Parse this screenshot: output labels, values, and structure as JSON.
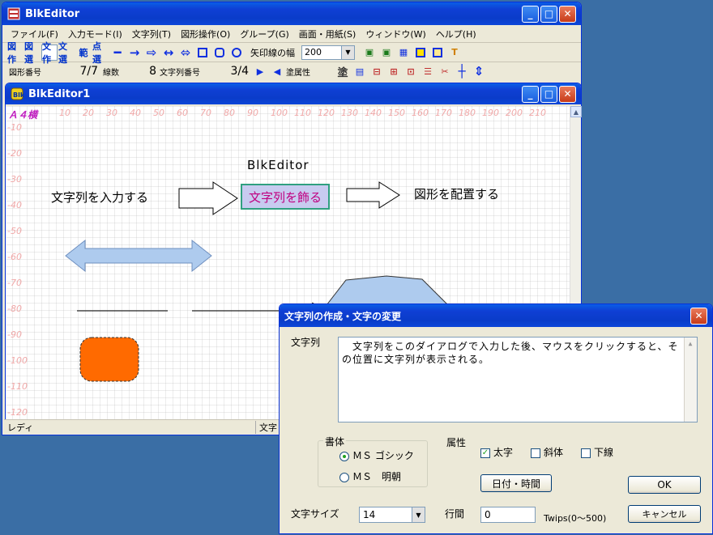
{
  "main_window": {
    "title": "BlkEditor",
    "menu": [
      "ファイル(F)",
      "入力モード(I)",
      "文字列(T)",
      "図形操作(O)",
      "グループ(G)",
      "画面・用紙(S)",
      "ウィンドウ(W)",
      "ヘルプ(H)"
    ],
    "toolbar": {
      "mode_buttons": [
        "図作",
        "図選",
        "文作",
        "文選",
        "範",
        "点選"
      ],
      "arrow_width_label": "矢印線の幅",
      "arrow_width_value": "200"
    },
    "toolbar2": {
      "shape_no_label": "図形番号",
      "shape_no_value": "7/7",
      "line_count_label": "線数",
      "line_count_value": "8",
      "string_no_label": "文字列番号",
      "string_no_value": "3/4",
      "fill_attr_label": "塗属性",
      "fill_glyph": "塗"
    },
    "status": [
      "レディ",
      "文字"
    ]
  },
  "child_window": {
    "title": "BlkEditor1",
    "paper_label": "Ａ４横",
    "ruler_x": [
      "10",
      "20",
      "30",
      "40",
      "50",
      "60",
      "70",
      "80",
      "90",
      "100",
      "110",
      "120",
      "130",
      "140",
      "150",
      "160",
      "170",
      "180",
      "190",
      "200",
      "210"
    ],
    "ruler_y": [
      "-10",
      "-20",
      "-30",
      "-40",
      "-50",
      "-60",
      "-70",
      "-80",
      "-90",
      "-100",
      "-110",
      "-120"
    ],
    "canvas_texts": {
      "heading": "BlkEditor",
      "step1": "文字列を入力する",
      "step2": "文字列を飾る",
      "step3": "図形を配置する"
    },
    "colors": {
      "orange": "#ff6a00",
      "light_blue": "#aecbee"
    }
  },
  "dialog": {
    "title": "文字列の作成・文字の変更",
    "string_label": "文字列",
    "string_value": "　文字列をこのダイアログで入力した後、マウスをクリックすると、その位置に文字列が表示される。",
    "font_group_label": "書体",
    "font_options": [
      "ＭＳ ゴシック",
      "ＭＳ　明朝"
    ],
    "attr_label": "属性",
    "bold_label": "太字",
    "italic_label": "斜体",
    "underline_label": "下線",
    "date_time_button": "日付・時間",
    "ok_button": "OK",
    "cancel_button": "キャンセル",
    "size_label": "文字サイズ",
    "size_value": "14",
    "line_spacing_label": "行間",
    "line_spacing_value": "0",
    "twips_label": "Twips(0～500)"
  }
}
